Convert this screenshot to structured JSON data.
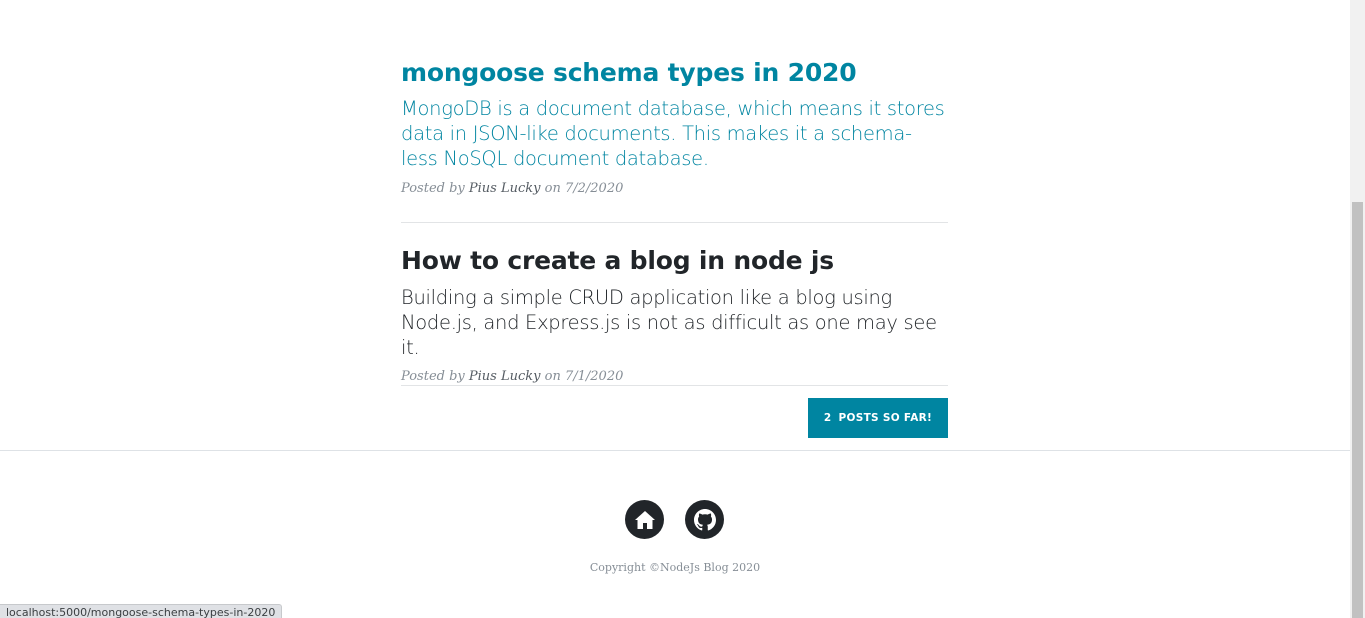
{
  "colors": {
    "accent": "#0085a1"
  },
  "posts": [
    {
      "title": "mongoose schema types in 2020",
      "subtitle": "MongoDB is a document database, which means it stores data in JSON-like documents. This makes it a schema-less NoSQL document database.",
      "meta_prefix": "Posted by",
      "author": "Pius Lucky",
      "meta_on": "on",
      "date": "7/2/2020"
    },
    {
      "title": "How to create a blog in node js",
      "subtitle": "Building a simple CRUD application like a blog using Node.js, and Express.js is not as difficult as one may see it.",
      "meta_prefix": "Posted by",
      "author": "Pius Lucky",
      "meta_on": "on",
      "date": "7/1/2020"
    }
  ],
  "post_count": {
    "count": "2",
    "label": "POSTS SO FAR!"
  },
  "footer": {
    "icons": [
      "home-icon",
      "github-icon"
    ],
    "copyright": "Copyright ©NodeJs Blog 2020"
  },
  "status_bar": {
    "url": "localhost:5000/mongoose-schema-types-in-2020"
  }
}
